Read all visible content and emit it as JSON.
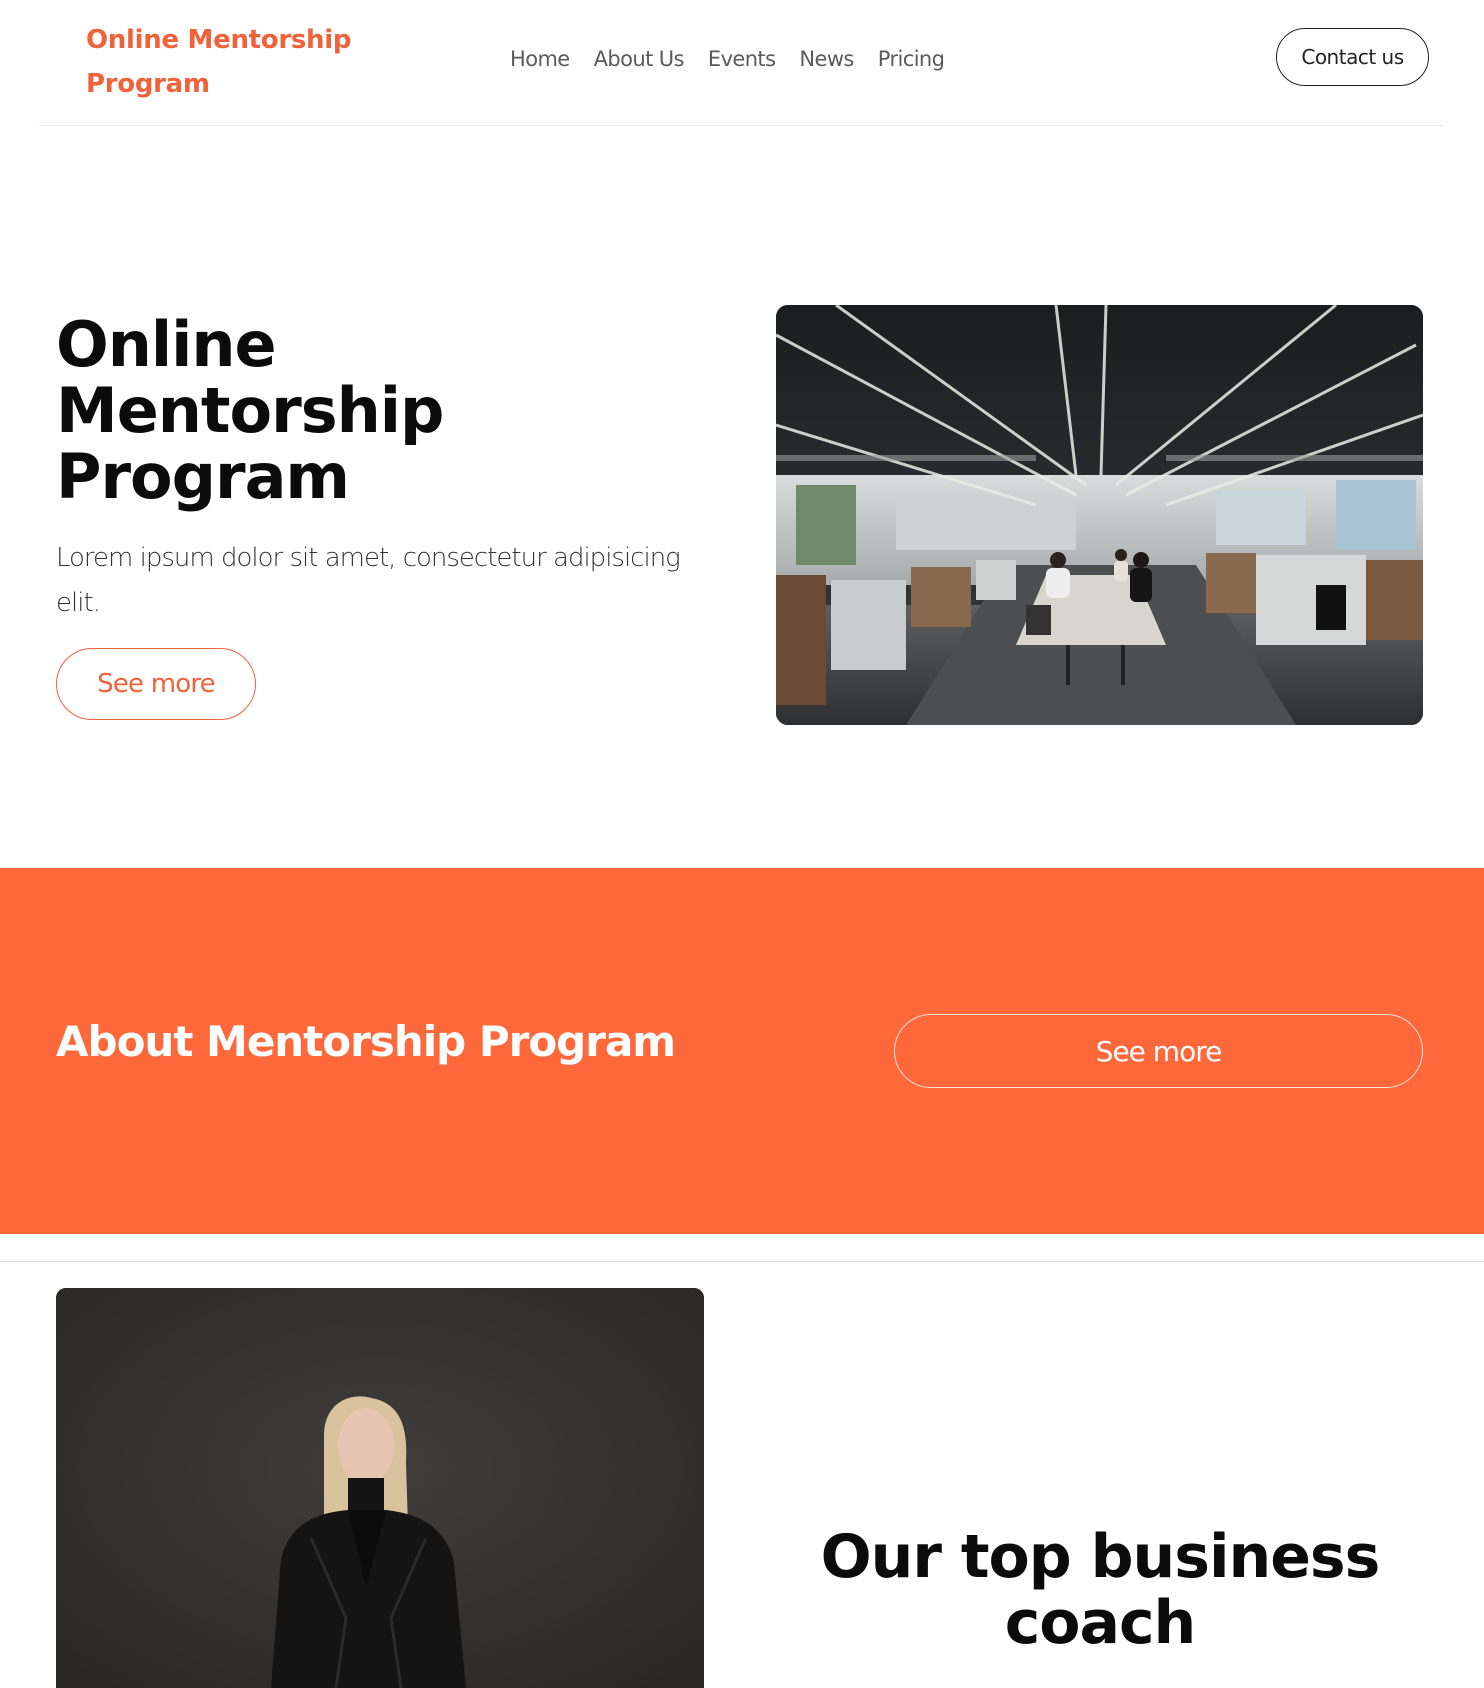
{
  "header": {
    "brand": "Online Mentorship Program",
    "nav": [
      "Home",
      "About Us",
      "Events",
      "News",
      "Pricing"
    ],
    "contact_label": "Contact us"
  },
  "hero": {
    "title": "Online Mentorship Program",
    "description": "Lorem ipsum dolor sit amet, consectetur adipisicing elit.",
    "button_label": "See more",
    "image_icon": "office-photo"
  },
  "about": {
    "title": "About Mentorship Program",
    "button_label": "See more"
  },
  "coach": {
    "title": "Our top business coach",
    "image_icon": "coach-portrait-photo"
  },
  "colors": {
    "accent": "#f0623a",
    "band": "#ff683a",
    "text": "#0b0b0b"
  }
}
